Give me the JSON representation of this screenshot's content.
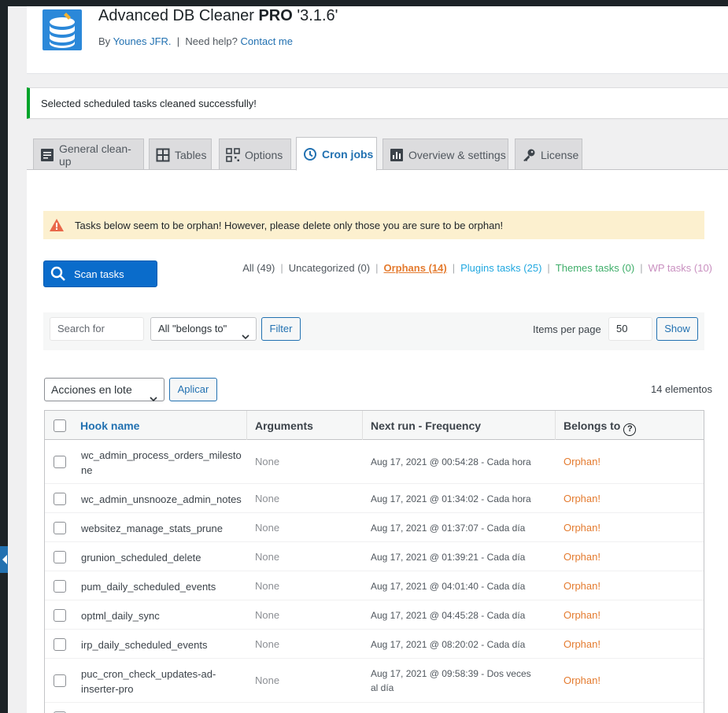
{
  "header": {
    "title": "Advanced DB Cleaner",
    "title_bold": "PRO",
    "version": "'3.1.6'",
    "by_label": "By",
    "author": "Younes JFR.",
    "separator": "|",
    "help_label": "Need help?",
    "contact_link": "Contact me"
  },
  "notice": {
    "text": "Selected scheduled tasks cleaned successfully!",
    "color": "#00a32a"
  },
  "tabs": [
    {
      "label": "General clean-up",
      "icon": "document-icon"
    },
    {
      "label": "Tables",
      "icon": "table-icon"
    },
    {
      "label": "Options",
      "icon": "qrcode-icon"
    },
    {
      "label": "Cron jobs",
      "icon": "clock-icon",
      "active": true
    },
    {
      "label": "Overview & settings",
      "icon": "chart-icon"
    },
    {
      "label": "License",
      "icon": "key-icon"
    }
  ],
  "warning": {
    "text": "Tasks below seem to be orphan! However, please delete only those you are sure to be orphan!"
  },
  "scan_button": "Scan tasks",
  "filters": {
    "all": "All (49)",
    "uncategorized": "Uncategorized (0)",
    "orphans": "Orphans (14)",
    "plugins": "Plugins tasks (25)",
    "themes": "Themes tasks (0)",
    "wp": "WP tasks (10)",
    "sep": "|"
  },
  "search": {
    "placeholder": "Search for",
    "belongs_select": "All \"belongs to\"",
    "filter_button": "Filter",
    "items_per_page_label": "Items per page",
    "items_per_page_value": "50",
    "show_button": "Show"
  },
  "bulk": {
    "select": "Acciones en lote",
    "apply_button": "Aplicar",
    "count": "14 elementos"
  },
  "table": {
    "columns": [
      "Hook name",
      "Arguments",
      "Next run - Frequency",
      "Belongs to"
    ],
    "help_glyph": "?",
    "rows": [
      {
        "hook": "wc_admin_process_orders_milestone",
        "args": "None",
        "next": "Aug 17, 2021 @ 00:54:28 - Cada hora",
        "belongs": "Orphan!"
      },
      {
        "hook": "wc_admin_unsnooze_admin_notes",
        "args": "None",
        "next": "Aug 17, 2021 @ 01:34:02 - Cada hora",
        "belongs": "Orphan!"
      },
      {
        "hook": "websitez_manage_stats_prune",
        "args": "None",
        "next": "Aug 17, 2021 @ 01:37:07 - Cada día",
        "belongs": "Orphan!"
      },
      {
        "hook": "grunion_scheduled_delete",
        "args": "None",
        "next": "Aug 17, 2021 @ 01:39:21 - Cada día",
        "belongs": "Orphan!"
      },
      {
        "hook": "pum_daily_scheduled_events",
        "args": "None",
        "next": "Aug 17, 2021 @ 04:01:40 - Cada día",
        "belongs": "Orphan!"
      },
      {
        "hook": "optml_daily_sync",
        "args": "None",
        "next": "Aug 17, 2021 @ 04:45:28 - Cada día",
        "belongs": "Orphan!"
      },
      {
        "hook": "irp_daily_scheduled_events",
        "args": "None",
        "next": "Aug 17, 2021 @ 08:20:02 - Cada día",
        "belongs": "Orphan!"
      },
      {
        "hook": "puc_cron_check_updates-ad-inserter-pro",
        "args": "None",
        "next": "Aug 17, 2021 @ 09:58:39 - Dos veces al día",
        "belongs": "Orphan!"
      }
    ]
  },
  "colors": {
    "primary": "#2271b1",
    "orphan": "#e47b2f",
    "success": "#00a32a",
    "warning_bg": "#fcf0cf"
  }
}
